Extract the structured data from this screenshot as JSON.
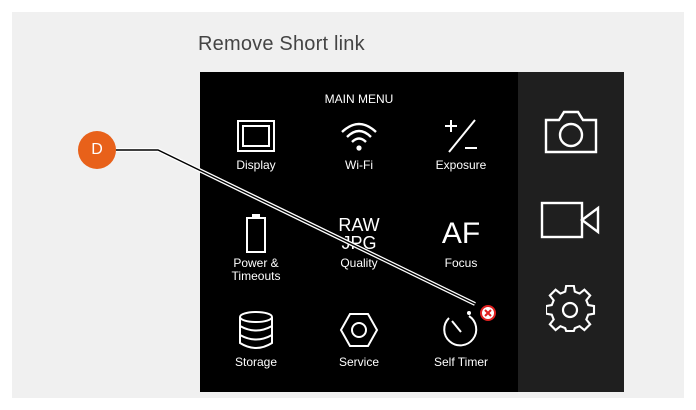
{
  "caption": "Remove Short link",
  "menu_title": "MAIN MENU",
  "marker_label": "D",
  "grid": [
    {
      "label": "Display",
      "icon": "display-icon"
    },
    {
      "label": "Wi-Fi",
      "icon": "wifi-icon"
    },
    {
      "label": "Exposure",
      "icon": "exposure-icon"
    },
    {
      "label": "Power &\nTimeouts",
      "icon": "battery-icon"
    },
    {
      "label": "Quality",
      "icon": "raw-jpg-icon",
      "icon_text": [
        "RAW",
        "JPG"
      ]
    },
    {
      "label": "Focus",
      "icon": "af-icon",
      "icon_text": "AF"
    },
    {
      "label": "Storage",
      "icon": "storage-icon"
    },
    {
      "label": "Service",
      "icon": "service-icon"
    },
    {
      "label": "Self Timer",
      "icon": "self-timer-icon"
    }
  ],
  "sidebar": [
    {
      "name": "photo-mode",
      "icon": "camera-icon"
    },
    {
      "name": "video-mode",
      "icon": "video-camera-icon"
    },
    {
      "name": "settings",
      "icon": "gear-icon"
    }
  ],
  "colors": {
    "marker": "#e8611a",
    "remove_badge": "#e02020",
    "screen": "#000000",
    "sidebar": "#1f1f1f"
  }
}
